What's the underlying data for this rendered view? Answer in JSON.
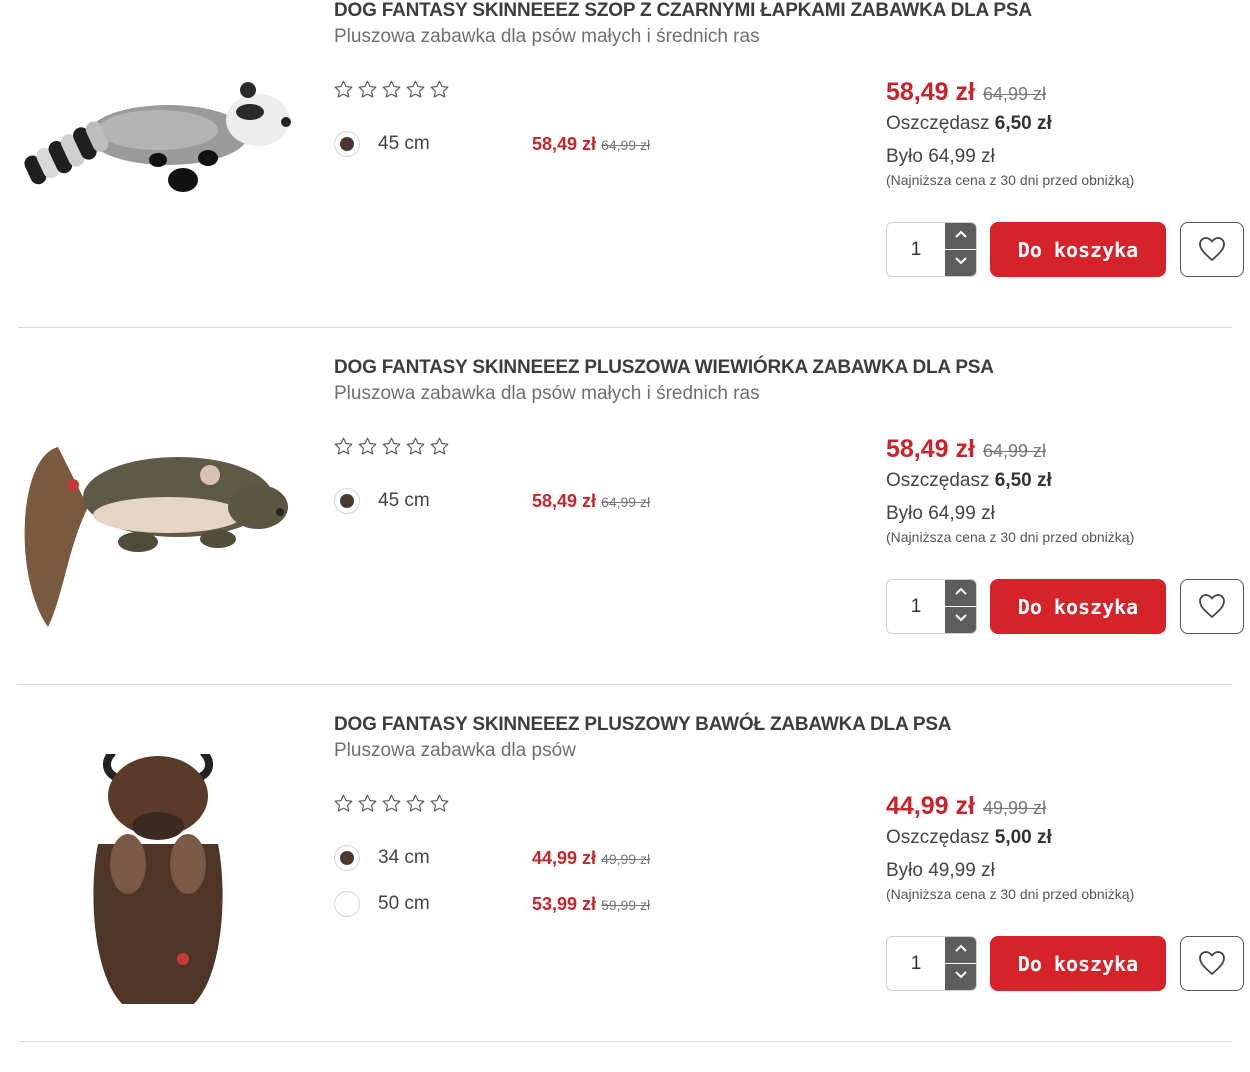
{
  "colors": {
    "accent": "#d62329",
    "price_red": "#c9242b",
    "stepper": "#5d5d5d"
  },
  "products": [
    {
      "title": "DOG FANTASY SKINNEEEZ SZOP Z CZARNYMI ŁAPKAMI ZABAWKA DLA PSA",
      "subtitle": "Pluszowa zabawka dla psów małych i średnich ras",
      "image_icon": "raccoon-plush-image",
      "rating": 0,
      "variants": [
        {
          "size": "45 cm",
          "price": "58,49 zł",
          "old_price": "64,99 zł",
          "selected": true
        }
      ],
      "price": "58,49 zł",
      "old_price": "64,99 zł",
      "save_label": "Oszczędasz",
      "save_amount": "6,50 zł",
      "was": "Było 64,99 zł",
      "lowest_note": "(Najniższa cena z 30 dni przed obniżką)",
      "quantity": "1",
      "cart_label": "Do koszyka"
    },
    {
      "title": "DOG FANTASY SKINNEEEZ PLUSZOWA WIEWIÓRKA ZABAWKA DLA PSA",
      "subtitle": "Pluszowa zabawka dla psów małych i średnich ras",
      "image_icon": "squirrel-plush-image",
      "rating": 0,
      "variants": [
        {
          "size": "45 cm",
          "price": "58,49 zł",
          "old_price": "64,99 zł",
          "selected": true
        }
      ],
      "price": "58,49 zł",
      "old_price": "64,99 zł",
      "save_label": "Oszczędasz",
      "save_amount": "6,50 zł",
      "was": "Było 64,99 zł",
      "lowest_note": "(Najniższa cena z 30 dni przed obniżką)",
      "quantity": "1",
      "cart_label": "Do koszyka"
    },
    {
      "title": "DOG FANTASY SKINNEEEZ PLUSZOWY BAWÓŁ ZABAWKA DLA PSA",
      "subtitle": "Pluszowa zabawka dla psów",
      "image_icon": "buffalo-plush-image",
      "rating": 0,
      "variants": [
        {
          "size": "34 cm",
          "price": "44,99 zł",
          "old_price": "49,99 zł",
          "selected": true
        },
        {
          "size": "50 cm",
          "price": "53,99 zł",
          "old_price": "59,99 zł",
          "selected": false
        }
      ],
      "price": "44,99 zł",
      "old_price": "49,99 zł",
      "save_label": "Oszczędasz",
      "save_amount": "5,00 zł",
      "was": "Było 49,99 zł",
      "lowest_note": "(Najniższa cena z 30 dni przed obniżką)",
      "quantity": "1",
      "cart_label": "Do koszyka"
    }
  ]
}
